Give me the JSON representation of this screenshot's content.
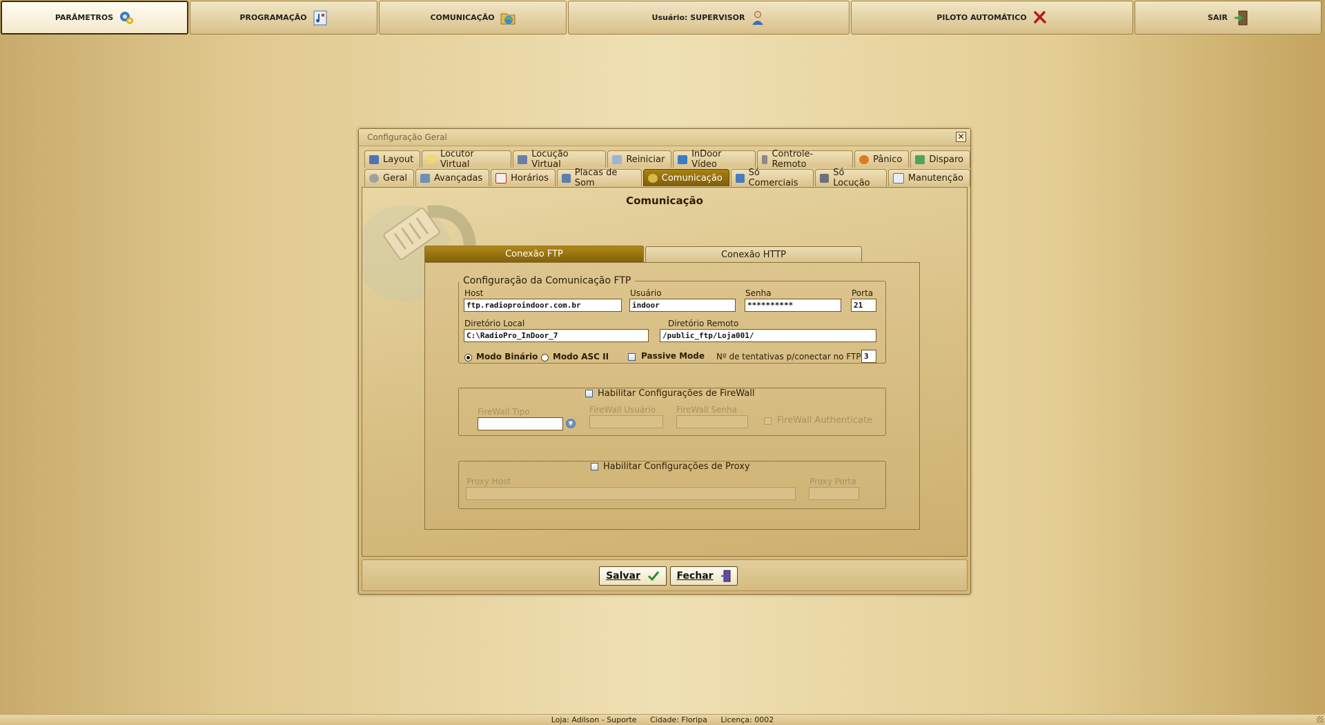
{
  "topbar": {
    "items": [
      {
        "label": "PARÂMETROS",
        "icon": "gears-icon"
      },
      {
        "label": "PROGRAMAÇÃO",
        "icon": "music-document-icon"
      },
      {
        "label": "COMUNICAÇÃO",
        "icon": "globe-folder-icon"
      },
      {
        "label": "Usuário: SUPERVISOR",
        "icon": "user-icon"
      },
      {
        "label": "PILOTO AUTOMÁTICO",
        "icon": "red-x-icon"
      },
      {
        "label": "SAIR",
        "icon": "exit-door-icon"
      }
    ]
  },
  "dialog": {
    "title": "Configuração Geral",
    "close": "✕",
    "tabs_row1": [
      "Layout",
      "Locutor Virtual",
      "Locução Virtual",
      "Reiniciar",
      "InDoor Vídeo",
      "Controle-Remoto",
      "Pânico",
      "Disparo"
    ],
    "tabs_row2": [
      "Geral",
      "Avançadas",
      "Horários",
      "Placas de Som",
      "Comunicação",
      "Só Comerciais",
      "Só Locução",
      "Manutenção"
    ],
    "selected_tab": "Comunicação",
    "content_title": "Comunicação",
    "subtabs": {
      "ftp": "Conexão FTP",
      "http": "Conexão HTTP"
    },
    "ftp": {
      "legend": "Configuração da Comunicação FTP",
      "host_label": "Host",
      "host": "ftp.radioproindoor.com.br",
      "user_label": "Usuário",
      "user": "indoor",
      "pass_label": "Senha",
      "pass": "**********",
      "port_label": "Porta",
      "port": "21",
      "localdir_label": "Diretório Local",
      "localdir": "C:\\RadioPro_InDoor_7",
      "remotedir_label": "Diretório Remoto",
      "remotedir": "/public_ftp/Loja001/",
      "mode_binary": "Modo Binário",
      "mode_ascii": "Modo ASC II",
      "passive": "Passive Mode",
      "retries_label": "Nº de tentativas p/conectar no FTP:",
      "retries": "3"
    },
    "firewall": {
      "legend": "Habilitar Configurações de FireWall",
      "type_label": "FireWall Tipo",
      "user_label": "FireWall Usuário",
      "pass_label": "FireWall Senha",
      "auth_label": "FireWall Authenticate"
    },
    "proxy": {
      "legend": "Habilitar Configurações de Proxy",
      "host_label": "Proxy Host",
      "port_label": "Proxy Porta"
    },
    "buttons": {
      "save": "Salvar",
      "close": "Fechar"
    }
  },
  "status": {
    "loja": "Loja: Adilson - Suporte",
    "cidade": "Cidade: Floripa",
    "licenca": "Licença: 0002"
  }
}
